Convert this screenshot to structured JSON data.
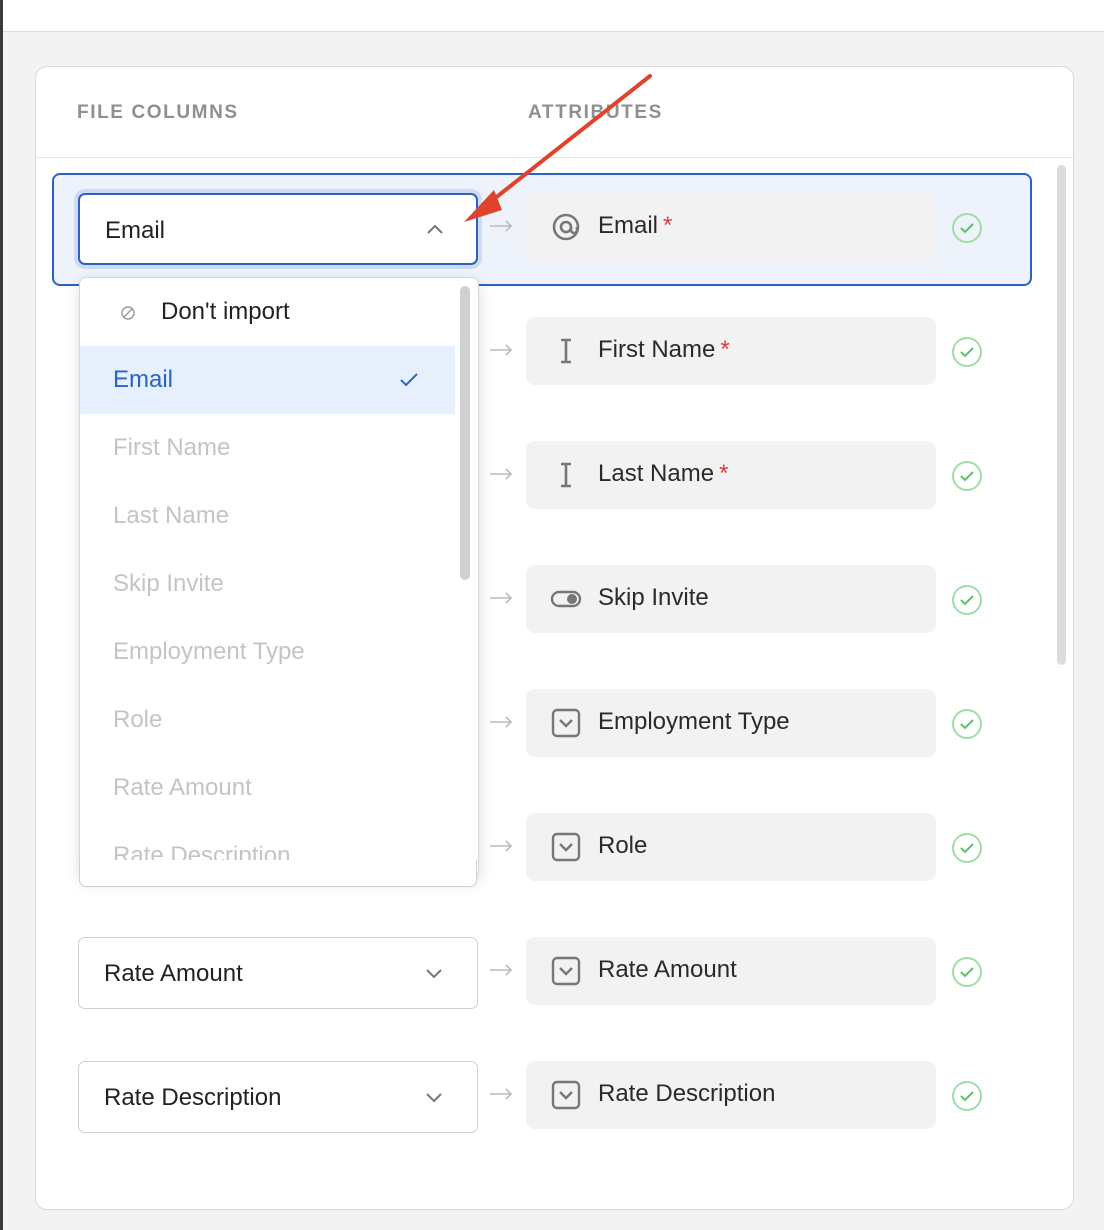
{
  "header": {
    "file_columns": "FILE COLUMNS",
    "attributes": "ATTRIBUTES"
  },
  "rows": [
    {
      "column": "Email",
      "attribute": "Email",
      "required": "*",
      "icon": "at-icon",
      "open": true
    },
    {
      "column": "",
      "attribute": "First Name",
      "required": "*",
      "icon": "text-icon"
    },
    {
      "column": "",
      "attribute": "Last Name",
      "required": "*",
      "icon": "text-icon"
    },
    {
      "column": "",
      "attribute": "Skip Invite",
      "required": "",
      "icon": "toggle-icon"
    },
    {
      "column": "",
      "attribute": "Employment Type",
      "required": "",
      "icon": "select-icon"
    },
    {
      "column": "",
      "attribute": "Role",
      "required": "",
      "icon": "select-icon"
    },
    {
      "column": "Rate Amount",
      "attribute": "Rate Amount",
      "required": "",
      "icon": "select-icon"
    },
    {
      "column": "Rate Description",
      "attribute": "Rate Description",
      "required": "",
      "icon": "select-icon"
    }
  ],
  "dropdown": {
    "options": [
      "Don't import",
      "Email",
      "First Name",
      "Last Name",
      "Skip Invite",
      "Employment Type",
      "Role",
      "Rate Amount",
      "Rate Description"
    ],
    "selected": "Email"
  },
  "colors": {
    "accent": "#2a63c4",
    "required": "#d93b3b",
    "success": "#5cc16a",
    "annotation": "#e0432b"
  }
}
